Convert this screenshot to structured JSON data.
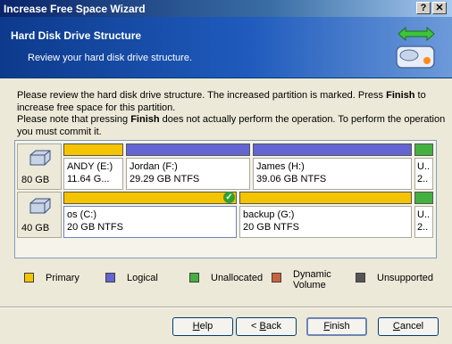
{
  "window": {
    "title": "Increase Free Space Wizard",
    "help_glyph": "?",
    "close_glyph": "✕"
  },
  "header": {
    "title": "Hard Disk Drive Structure",
    "subtitle": "Review your hard disk drive structure.",
    "icon": "disk-resize-icon"
  },
  "intro": {
    "line1_a": "Please review the hard disk drive structure. The increased partition is marked. Press ",
    "line1_b": "Finish",
    "line1_c": " to increase free space for this partition.",
    "line2_a": "Please note that pressing ",
    "line2_b": "Finish",
    "line2_c": " does not actually perform the operation. To perform the operation you must commit it."
  },
  "disks": [
    {
      "size": "80 GB",
      "partitions": [
        {
          "name": "ANDY (E:)",
          "info": "11.64 G...",
          "type": "Primary"
        },
        {
          "name": "Jordan (F:)",
          "info": "29.29 GB  NTFS",
          "type": "Logical"
        },
        {
          "name": "James (H:)",
          "info": "39.06 GB  NTFS",
          "type": "Logical"
        },
        {
          "name": "U..",
          "info": "2..",
          "type": "Unallocated"
        }
      ]
    },
    {
      "size": "40 GB",
      "partitions": [
        {
          "name": "os (C:)",
          "info": "20 GB  NTFS",
          "type": "Primary",
          "marked": true,
          "check_glyph": "✓"
        },
        {
          "name": "backup (G:)",
          "info": "20 GB  NTFS",
          "type": "Primary"
        },
        {
          "name": "U..",
          "info": "2..",
          "type": "Unallocated"
        }
      ]
    }
  ],
  "legend": [
    {
      "label": "Primary",
      "color": "#f5c400"
    },
    {
      "label": "Logical",
      "color": "#6464d2"
    },
    {
      "label": "Unallocated",
      "color": "#44b040"
    },
    {
      "label": "Dynamic Volume",
      "color": "#c8643c"
    },
    {
      "label": "Unsupported",
      "color": "#555555"
    }
  ],
  "colors": {
    "primary": "#f5c400",
    "logical": "#6464d2",
    "unallocated": "#44b040"
  },
  "buttons": {
    "help": {
      "prefix": "",
      "accel": "H",
      "suffix": "elp"
    },
    "back": {
      "prefix": "< ",
      "accel": "B",
      "suffix": "ack"
    },
    "finish": {
      "prefix": "",
      "accel": "F",
      "suffix": "inish"
    },
    "cancel": {
      "prefix": "",
      "accel": "C",
      "suffix": "ancel"
    }
  }
}
